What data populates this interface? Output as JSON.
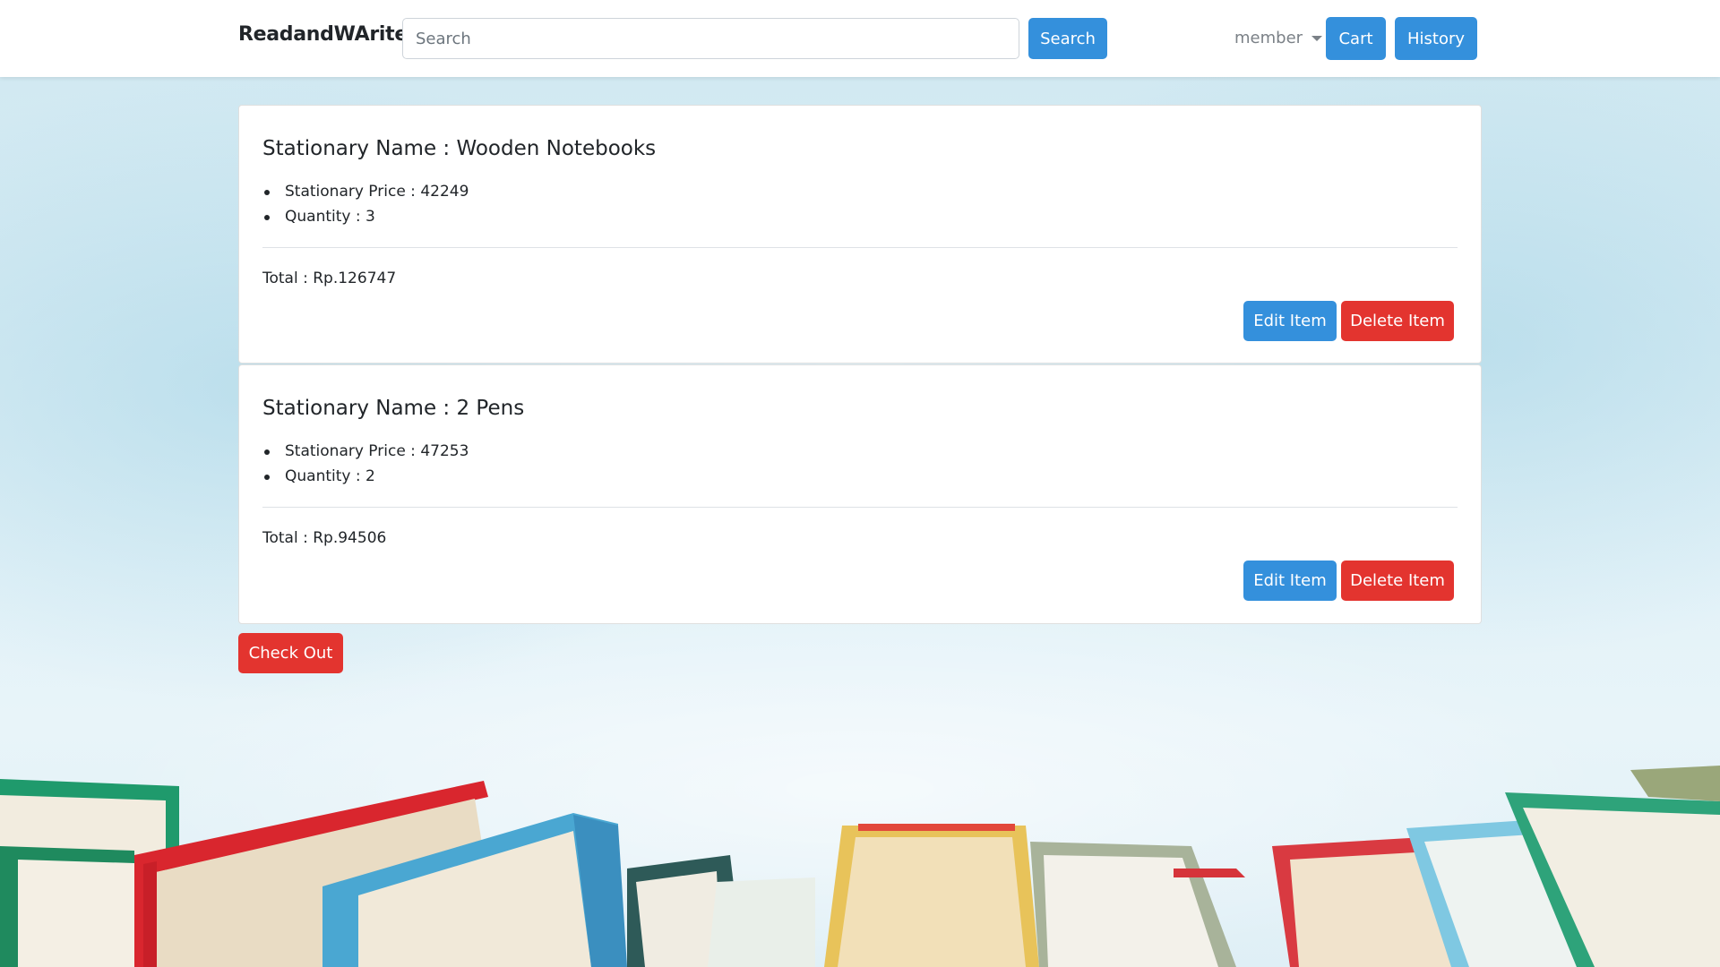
{
  "navbar": {
    "brand": "ReadandWArite",
    "search": {
      "placeholder": "Search",
      "value": "",
      "button_label": "Search"
    },
    "member_label": "member",
    "cart_label": "Cart",
    "history_label": "History"
  },
  "cart_items": [
    {
      "title": "Stationary Name : Wooden Notebooks",
      "price_text": "Stationary Price : 42249",
      "quantity_text": "Quantity : 3",
      "total_text": "Total : Rp.126747",
      "edit_label": "Edit Item",
      "delete_label": "Delete Item"
    },
    {
      "title": "Stationary Name : 2 Pens",
      "price_text": "Stationary Price : 47253",
      "quantity_text": "Quantity : 2",
      "total_text": "Total : Rp.94506",
      "edit_label": "Edit Item",
      "delete_label": "Delete Item"
    }
  ],
  "checkout_label": "Check Out",
  "colors": {
    "primary": "#3490dc",
    "danger": "#e3342f",
    "background": "#d8ecf4"
  }
}
